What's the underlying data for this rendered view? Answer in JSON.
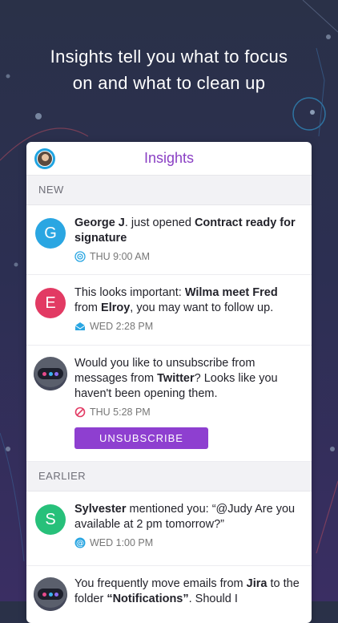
{
  "headline": {
    "line1": "Insights tell you what to focus",
    "line2": "on and what to clean up"
  },
  "card": {
    "title": "Insights",
    "sections": {
      "new_label": "NEW",
      "earlier_label": "EARLIER"
    },
    "items": [
      {
        "avatar_letter": "G",
        "avatar_color": "#2aa6e2",
        "text": {
          "bold1": "George J",
          "plain1": ". just opened ",
          "bold2": "Contract ready for signature"
        },
        "icon": "broadcast-icon",
        "time": "THU 9:00 AM"
      },
      {
        "avatar_letter": "E",
        "avatar_color": "#e23a63",
        "text": {
          "plain1": "This looks important: ",
          "bold1": "Wilma meet Fred",
          "plain2": " from ",
          "bold2": "Elroy",
          "plain3": ", you may want to follow up."
        },
        "icon": "envelope-open-icon",
        "time": "WED 2:28 PM"
      },
      {
        "avatar": "robot",
        "text": {
          "plain1": "Would you like to unsubscribe from messages from ",
          "bold1": "Twitter",
          "plain2": "? Looks like you haven't been opening them."
        },
        "icon": "blocked-icon",
        "time": "THU 5:28 PM",
        "button": "UNSUBSCRIBE"
      },
      {
        "avatar_letter": "S",
        "avatar_color": "#27c07a",
        "text": {
          "bold1": "Sylvester",
          "plain1": " mentioned you: “@Judy Are you available at 2 pm tomorrow?”"
        },
        "icon": "at-icon",
        "time": "WED 1:00 PM"
      },
      {
        "avatar": "robot",
        "text": {
          "plain1": "You frequently move emails from ",
          "bold1": "Jira",
          "plain2": " to the folder ",
          "bold2": "“Notifications”",
          "plain3": ". Should I"
        }
      }
    ]
  },
  "colors": {
    "accent": "#8e3fd0",
    "title": "#8a3fc4",
    "robot_dots": [
      "#e64a8a",
      "#3bb3f0",
      "#8b6cf0"
    ]
  }
}
